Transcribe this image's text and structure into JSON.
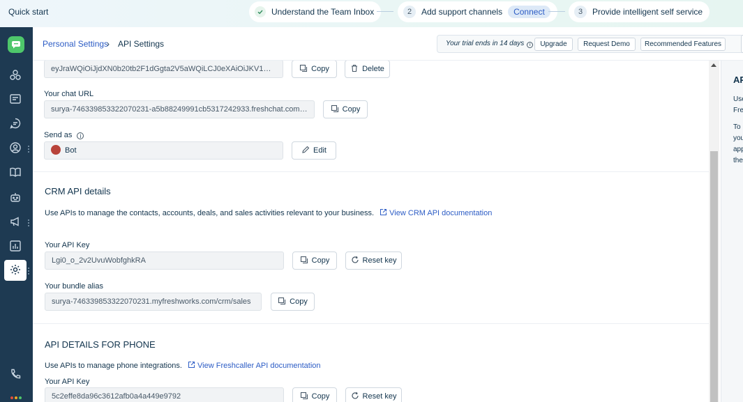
{
  "topbar": {
    "title": "Quick start",
    "steps": [
      {
        "label": "Understand the Team Inbox",
        "status": "done"
      },
      {
        "number": "2",
        "label": "Add support channels",
        "action": "Connect"
      },
      {
        "number": "3",
        "label": "Provide intelligent self service"
      }
    ]
  },
  "nav": {
    "items": [
      {
        "icon": "team-inbox-icon"
      },
      {
        "icon": "conversations-icon"
      },
      {
        "icon": "chat-bubble-icon"
      },
      {
        "icon": "contacts-icon"
      },
      {
        "icon": "knowledge-base-icon"
      },
      {
        "icon": "bot-icon"
      },
      {
        "icon": "campaigns-icon"
      },
      {
        "icon": "reports-icon"
      },
      {
        "icon": "settings-icon",
        "active": true
      }
    ],
    "bottom_icon": "phone-icon"
  },
  "header": {
    "breadcrumb_parent": "Personal Settings",
    "breadcrumb_separator": "›",
    "breadcrumb_current": "API Settings",
    "trial_text": "Your trial ends in 14 days",
    "upgrade_label": "Upgrade",
    "request_demo_label": "Request Demo",
    "recommended_label": "Recommended Features"
  },
  "chat": {
    "token_value": "eyJraWQiOiJjdXN0b20tb2F1dGgta2V5aWQiLCJ0eXAiOiJKV1QiL...",
    "copy_label": "Copy",
    "delete_label": "Delete",
    "url_label": "Your chat URL",
    "url_value": "surya-746339853322070231-a5b88249991cb5317242933.freshchat.com/v2",
    "send_as_label": "Send as",
    "send_as_value": "Bot",
    "edit_label": "Edit"
  },
  "crm": {
    "title": "CRM API details",
    "description": "Use APIs to manage the contacts, accounts, deals, and sales activities relevant to your business.",
    "doc_link": "View CRM API documentation",
    "api_key_label": "Your API Key",
    "api_key_value": "Lgi0_o_2v2UvuWobfghkRA",
    "copy_label": "Copy",
    "reset_label": "Reset key",
    "bundle_label": "Your bundle alias",
    "bundle_value": "surya-746339853322070231.myfreshworks.com/crm/sales"
  },
  "phone": {
    "title": "API DETAILS FOR PHONE",
    "description": "Use APIs to manage phone integrations.",
    "doc_link": "View Freshcaller API documentation",
    "api_key_label": "Your API Key",
    "api_key_value": "5c2effe8da96c3612afb0a4a449e9792",
    "copy_label": "Copy",
    "reset_label": "Reset key"
  },
  "rightpanel": {
    "title": "AP",
    "lines": [
      "Use",
      "Fre",
      "To",
      "you",
      "app",
      "the"
    ]
  },
  "colors": {
    "nav_bg": "#1e3a52",
    "link": "#2c5cc5",
    "text": "#12344d",
    "logo": "#4ec76b"
  }
}
